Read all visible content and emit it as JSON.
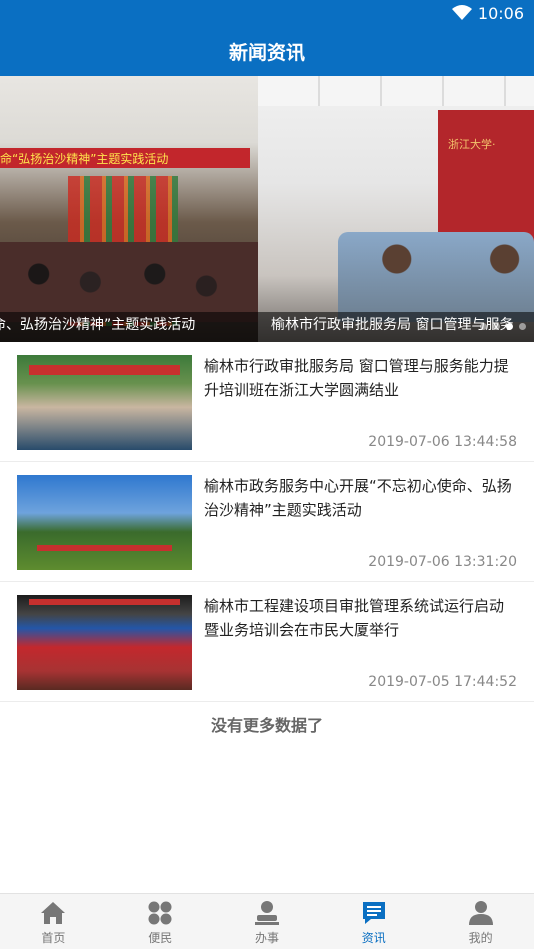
{
  "status_bar": {
    "time": "10:06"
  },
  "header": {
    "title": "新闻资讯"
  },
  "carousel": {
    "slides": [
      {
        "caption": "命、弘扬治沙精神”主题实践活动",
        "banner": "命“弘扬治沙精神”主题实践活动"
      },
      {
        "caption": "榆林市行政审批服务局 窗口管理与服务",
        "banner": "浙江大学·"
      }
    ],
    "page_count": 4,
    "active_index": 2
  },
  "news": [
    {
      "title": "榆林市行政审批服务局 窗口管理与服务能力提升培训班在浙江大学圆满结业",
      "time": "2019-07-06 13:44:58"
    },
    {
      "title": "榆林市政务服务中心开展“不忘初心使命、弘扬治沙精神”主题实践活动",
      "time": "2019-07-06 13:31:20"
    },
    {
      "title": "榆林市工程建设项目审批管理系统试运行启动暨业务培训会在市民大厦举行",
      "time": "2019-07-05 17:44:52"
    }
  ],
  "list_footer": "没有更多数据了",
  "tabbar": {
    "active": "资讯",
    "tabs": [
      {
        "label": "首页",
        "icon": "home-icon"
      },
      {
        "label": "便民",
        "icon": "apps-icon"
      },
      {
        "label": "办事",
        "icon": "service-icon"
      },
      {
        "label": "资讯",
        "icon": "news-icon"
      },
      {
        "label": "我的",
        "icon": "profile-icon"
      }
    ]
  },
  "colors": {
    "primary": "#0a6fc2",
    "text": "#222222",
    "muted": "#888888"
  }
}
